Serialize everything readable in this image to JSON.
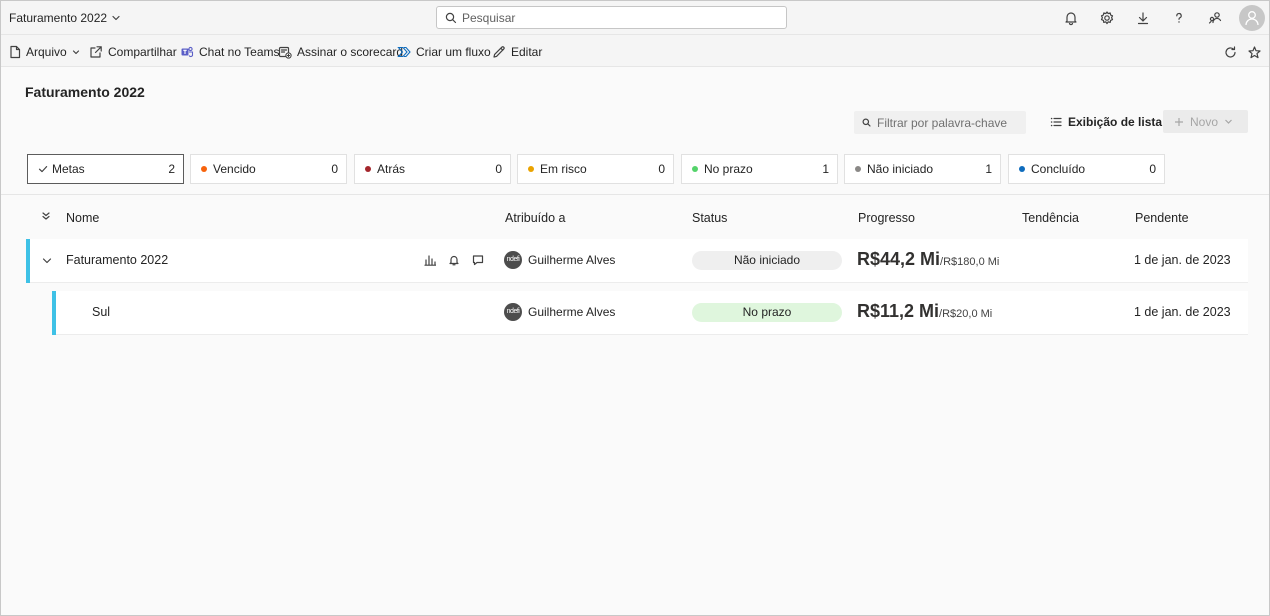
{
  "app": {
    "title": "Faturamento 2022"
  },
  "search": {
    "placeholder": "Pesquisar"
  },
  "toolbar": {
    "file": "Arquivo",
    "share": "Compartilhar",
    "teams": "Chat no Teams",
    "subscribe": "Assinar o scorecard",
    "flow": "Criar um fluxo",
    "edit": "Editar"
  },
  "page": {
    "title": "Faturamento 2022",
    "filter_placeholder": "Filtrar por palavra-chave",
    "list_view": "Exibição de lista",
    "new_label": "Novo"
  },
  "status_filters": [
    {
      "label": "Metas",
      "count": "2",
      "color": ""
    },
    {
      "label": "Vencido",
      "count": "0",
      "color": "#f7630c"
    },
    {
      "label": "Atrás",
      "count": "0",
      "color": "#a4262c"
    },
    {
      "label": "Em risco",
      "count": "0",
      "color": "#eaa300"
    },
    {
      "label": "No prazo",
      "count": "1",
      "color": "#54d36a"
    },
    {
      "label": "Não iniciado",
      "count": "1",
      "color": "#8a8886"
    },
    {
      "label": "Concluído",
      "count": "0",
      "color": "#0f6cbd"
    }
  ],
  "table": {
    "headers": [
      "Nome",
      "Atribuído a",
      "Status",
      "Progresso",
      "Tendência",
      "Pendente"
    ],
    "rows": [
      {
        "name": "Faturamento 2022",
        "assignee": "Guilherme Alves",
        "avatar_text": "ndefi",
        "status": "Não iniciado",
        "status_color": "#efefef",
        "value": "R$44,2 Mi",
        "target": "/R$180,0 Mi",
        "due": "1 de jan. de 2023"
      },
      {
        "name": "Sul",
        "assignee": "Guilherme Alves",
        "avatar_text": "ndefi",
        "status": "No prazo",
        "status_color": "#dff6dd",
        "value": "R$11,2 Mi",
        "target": "/R$20,0 Mi",
        "due": "1 de jan. de 2023"
      }
    ]
  },
  "colors": {
    "accent_bar": "#3ec1e6"
  }
}
